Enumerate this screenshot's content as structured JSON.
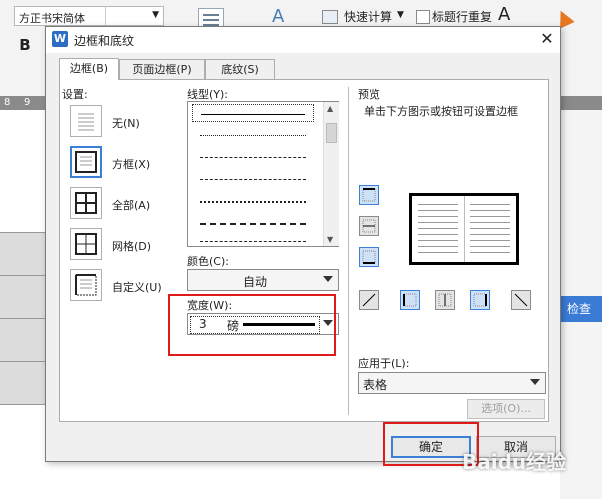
{
  "app": {
    "font_name": "方正书宋简体",
    "bold_label": "B",
    "quick_calc": "快速计算",
    "title_repeat": "标题行重复",
    "ruler_ticks": [
      "8",
      "9"
    ],
    "check_button": "检查"
  },
  "dialog": {
    "icon_letter": "W",
    "title": "边框和底纹",
    "close_glyph": "✕",
    "tabs": [
      "边框(B)",
      "页面边框(P)",
      "底纹(S)"
    ],
    "settings_label": "设置:",
    "settings": [
      {
        "label": "无(N)"
      },
      {
        "label": "方框(X)",
        "selected": true
      },
      {
        "label": "全部(A)"
      },
      {
        "label": "网格(D)"
      },
      {
        "label": "自定义(U)"
      }
    ],
    "line_style_label": "线型(Y):",
    "color_label": "颜色(C):",
    "color_value": "自动",
    "width_label": "宽度(W):",
    "width_value": "3",
    "width_unit": "磅",
    "preview_label": "预览",
    "preview_hint": "单击下方图示或按钮可设置边框",
    "apply_label": "应用于(L):",
    "apply_value": "表格",
    "options_button": "选项(O)...",
    "ok_button": "确定",
    "cancel_button": "取消"
  },
  "watermark": "Baidu经验",
  "colors": {
    "accent": "#3c7fd6",
    "highlight": "#e0191b",
    "check_button_bg": "#3a7bd5"
  }
}
